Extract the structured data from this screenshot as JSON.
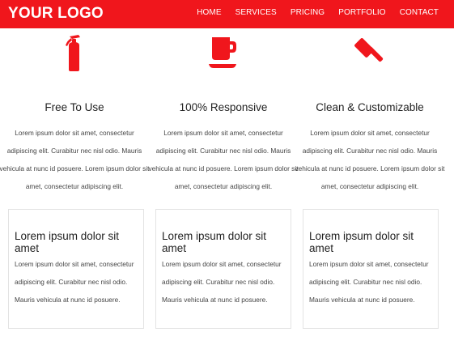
{
  "header": {
    "logo": "YOUR LOGO",
    "nav": [
      "HOME",
      "SERVICES",
      "PRICING",
      "PORTFOLIO",
      "CONTACT"
    ]
  },
  "colors": {
    "accent": "#f0161c"
  },
  "features": [
    {
      "icon": "fire-extinguisher-icon",
      "title": "Free To Use",
      "text": "Lorem ipsum dolor sit amet, consectetur adipiscing elit. Curabitur nec nisl odio. Mauris vehicula at nunc id posuere. Lorem ipsum dolor sit amet, consectetur adipiscing elit."
    },
    {
      "icon": "coffee-cup-icon",
      "title": "100% Responsive",
      "text": "Lorem ipsum dolor sit amet, consectetur adipiscing elit. Curabitur nec nisl odio. Mauris vehicula at nunc id posuere. Lorem ipsum dolor sit amet, consectetur adipiscing elit."
    },
    {
      "icon": "gavel-icon",
      "title": "Clean & Customizable",
      "text": "Lorem ipsum dolor sit amet, consectetur adipiscing elit. Curabitur nec nisl odio. Mauris vehicula at nunc id posuere. Lorem ipsum dolor sit amet, consectetur adipiscing elit."
    }
  ],
  "cards": [
    {
      "title": "Lorem ipsum dolor sit amet",
      "text": "Lorem ipsum dolor sit amet, consectetur adipiscing elit. Curabitur nec nisl odio. Mauris vehicula at nunc id posuere."
    },
    {
      "title": "Lorem ipsum dolor sit amet",
      "text": "Lorem ipsum dolor sit amet, consectetur adipiscing elit. Curabitur nec nisl odio. Mauris vehicula at nunc id posuere."
    },
    {
      "title": "Lorem ipsum dolor sit amet",
      "text": "Lorem ipsum dolor sit amet, consectetur adipiscing elit. Curabitur nec nisl odio. Mauris vehicula at nunc id posuere."
    }
  ]
}
